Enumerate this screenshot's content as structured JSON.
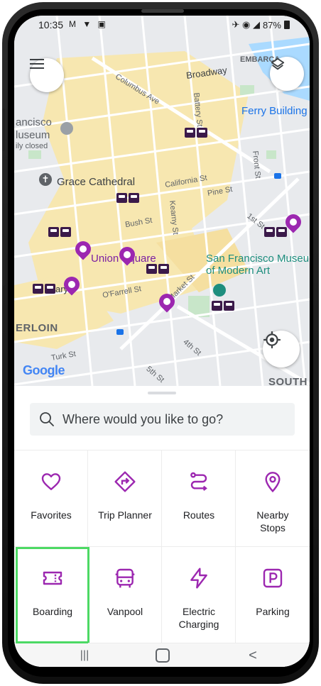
{
  "status": {
    "time": "10:35",
    "left_icons": "M ▼ ▣",
    "battery": "87%"
  },
  "map": {
    "labels": {
      "embarcadero": "EMBARCA",
      "broadway": "Broadway",
      "columbus": "Columbus Ave",
      "battery": "Battery St",
      "ferry": "Ferry Building",
      "francisco": "ancisco",
      "museum": "luseum",
      "closed": "ily closed",
      "front": "Front St",
      "grace": "Grace Cathedral",
      "california": "California St",
      "pine": "Pine St",
      "bush": "Bush St",
      "kearny": "Kearny St",
      "first": "1st St",
      "union": "Union Square",
      "sfmoma_1": "San Francisco Museum",
      "sfmoma_2": "of Modern Art",
      "ary": "ary",
      "ofarrell": "O'Farrell St",
      "market": "Market St",
      "tenderloin": "ERLOIN",
      "turk": "Turk St",
      "fourth": "4th St",
      "fifth": "5th St",
      "south": "SOUTH",
      "google": "Google"
    }
  },
  "search": {
    "placeholder": "Where would you like to go?"
  },
  "tiles": [
    {
      "label": "Favorites",
      "icon": "heart-icon"
    },
    {
      "label": "Trip Planner",
      "icon": "directions-icon"
    },
    {
      "label": "Routes",
      "icon": "route-icon"
    },
    {
      "label": "Nearby\nStops",
      "icon": "location-pin-icon"
    },
    {
      "label": "Boarding",
      "icon": "ticket-icon"
    },
    {
      "label": "Vanpool",
      "icon": "bus-icon"
    },
    {
      "label": "Electric\nCharging",
      "icon": "lightning-icon"
    },
    {
      "label": "Parking",
      "icon": "parking-icon"
    }
  ],
  "nav": {
    "recents": "|||",
    "home": "○",
    "back": "<"
  },
  "colors": {
    "accent": "#9c27b0",
    "selected_outline": "#4cd964"
  }
}
